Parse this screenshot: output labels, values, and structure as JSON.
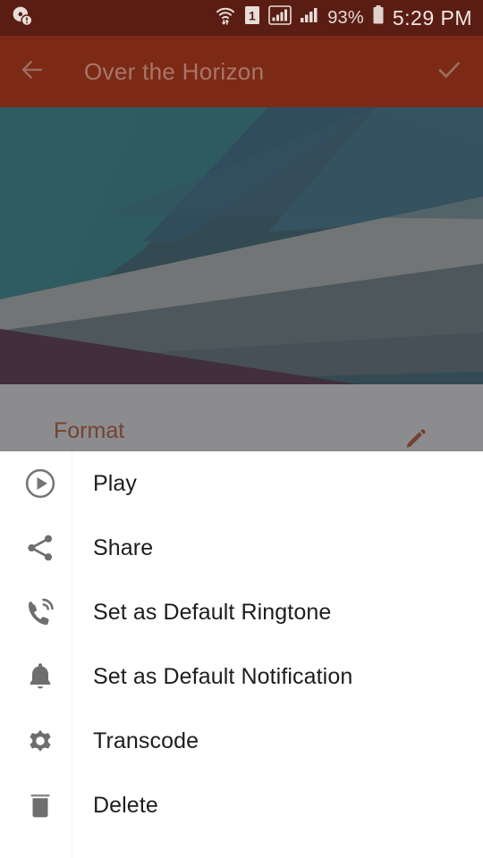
{
  "status_bar": {
    "left_icons": [
      {
        "name": "disc-info-icon",
        "glyph": "disc"
      }
    ],
    "right_icons": [
      {
        "name": "wifi-transfer-icon",
        "glyph": "wifi"
      },
      {
        "name": "sim-one-icon",
        "glyph": "sim",
        "label": "1"
      },
      {
        "name": "signal-boxed-icon",
        "glyph": "signal-boxed"
      },
      {
        "name": "signal-bars-icon",
        "glyph": "signal"
      }
    ],
    "battery_percent": "93%",
    "battery_icon": "battery-full-icon",
    "clock": "5:29 PM",
    "background_color": "#5a1d14"
  },
  "app_bar": {
    "back_icon": "back-arrow-icon",
    "title": "Over the Horizon",
    "confirm_icon": "check-icon",
    "background_color": "#7c2a16",
    "title_color": "#a8766a"
  },
  "artwork": {
    "name": "album-art",
    "overflow_icon": "overflow-menu-icon",
    "palette": {
      "teal": "#0e8287",
      "teal_dark": "#0a6f74",
      "blue": "#155e7d",
      "blue_mid": "#1d6c87",
      "steel": "#2b6d82",
      "sage": "#b9c3bb",
      "sage_dark": "#9aa79f",
      "slate": "#3f5b60",
      "maroon": "#3c0b22",
      "dark": "#14343d"
    }
  },
  "detail_strip": {
    "label": "Format",
    "label_color": "#c1400a",
    "edit_icon": "pencil-edit-icon"
  },
  "scrim": {
    "name": "dim-overlay",
    "color": "#46464a"
  },
  "menu": {
    "name": "context-action-sheet",
    "items": [
      {
        "label": "Play",
        "icon": "play-circle-icon"
      },
      {
        "label": "Share",
        "icon": "share-icon"
      },
      {
        "label": "Set as Default Ringtone",
        "icon": "ringtone-phone-icon"
      },
      {
        "label": "Set as Default Notification",
        "icon": "bell-icon"
      },
      {
        "label": "Transcode",
        "icon": "gear-icon"
      },
      {
        "label": "Delete",
        "icon": "trash-icon"
      }
    ],
    "icon_color": "#6e6e6e",
    "label_color": "#1d1d1d",
    "background_color": "#ffffff"
  }
}
